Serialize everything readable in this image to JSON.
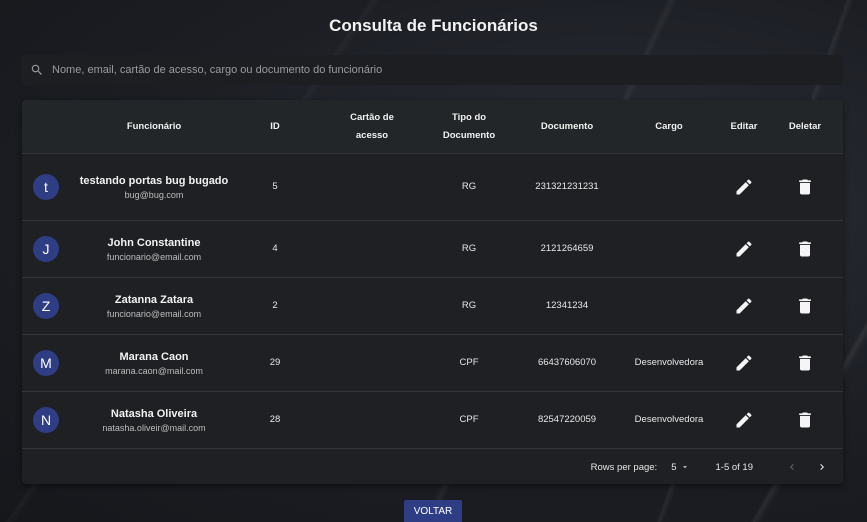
{
  "page": {
    "title": "Consulta de Funcionários"
  },
  "search": {
    "placeholder": "Nome, email, cartão de acesso, cargo ou documento do funcionário",
    "value": ""
  },
  "table": {
    "headers": {
      "funcionario": "Funcionário",
      "id": "ID",
      "cartao": "Cartão de acesso",
      "tipo": "Tipo do Documento",
      "documento": "Documento",
      "cargo": "Cargo",
      "editar": "Editar",
      "deletar": "Deletar"
    },
    "rows": [
      {
        "initial": "t",
        "name": "testando portas bug bugado",
        "email": "bug@bug.com",
        "id": "5",
        "cartao": "",
        "tipo": "RG",
        "documento": "231321231231",
        "cargo": ""
      },
      {
        "initial": "J",
        "name": "John Constantine",
        "email": "funcionario@email.com",
        "id": "4",
        "cartao": "",
        "tipo": "RG",
        "documento": "2121264659",
        "cargo": ""
      },
      {
        "initial": "Z",
        "name": "Zatanna Zatara",
        "email": "funcionario@email.com",
        "id": "2",
        "cartao": "",
        "tipo": "RG",
        "documento": "12341234",
        "cargo": ""
      },
      {
        "initial": "M",
        "name": "Marana Caon",
        "email": "marana.caon@mail.com",
        "id": "29",
        "cartao": "",
        "tipo": "CPF",
        "documento": "66437606070",
        "cargo": "Desenvolvedora"
      },
      {
        "initial": "N",
        "name": "Natasha Oliveira",
        "email": "natasha.oliveir@mail.com",
        "id": "28",
        "cartao": "",
        "tipo": "CPF",
        "documento": "82547220059",
        "cargo": "Desenvolvedora"
      }
    ],
    "icons": {
      "edit": "pencil-icon",
      "delete": "trash-icon"
    }
  },
  "pagination": {
    "rows_per_page_label": "Rows per page:",
    "rows_per_page": "5",
    "range": "1-5 of 19"
  },
  "voltar_label": "VOLTAR",
  "colors": {
    "accent": "#2f3d85",
    "surface": "#1e2023",
    "header": "#222628"
  }
}
